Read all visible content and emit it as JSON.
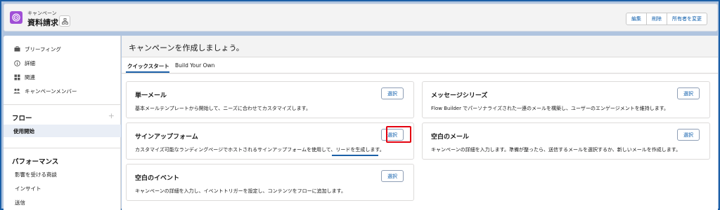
{
  "header": {
    "object_type": "キャンペーン",
    "title": "資料請求",
    "actions": [
      "編集",
      "削除",
      "所有者を変更"
    ],
    "icon": "campaign-target-icon"
  },
  "sidebar": {
    "top_items": [
      {
        "label": "ブリーフィング",
        "icon": "briefcase-icon"
      },
      {
        "label": "詳細",
        "icon": "info-icon"
      },
      {
        "label": "関連",
        "icon": "grid-icon"
      },
      {
        "label": "キャンペーンメンバー",
        "icon": "members-icon"
      }
    ],
    "flow_heading": "フロー",
    "flow_active": "使用開始",
    "performance_heading": "パフォーマンス",
    "performance_items": [
      "影響を受ける商談",
      "インサイト",
      "送信"
    ]
  },
  "main": {
    "title": "キャンペーンを作成しましょう。",
    "tabs": [
      "クイックスタート",
      "Build Your Own"
    ],
    "select_label": "選択",
    "cards": [
      {
        "title": "単一メール",
        "desc": "基本メールテンプレートから開始して、ニーズに合わせてカスタマイズします。"
      },
      {
        "title": "メッセージシリーズ",
        "desc": "Flow Builder でパーソナライズされた一連のメールを構築し、ユーザーのエンゲージメントを維持します。"
      },
      {
        "title": "サインアップフォーム",
        "desc": "カスタマイズ可能なランディングページでホストされるサインアップフォームを使用して、リードを生成します。"
      },
      {
        "title": "空白のメール",
        "desc": "キャンペーンの詳細を入力します。準備が整ったら、送信するメールを選択するか、新しいメールを作成します。"
      },
      {
        "title": "空白のイベント",
        "desc": "キャンペーンの詳細を入力し、イベントトリガーを設定し、コンテンツをフローに追加します。"
      }
    ]
  },
  "colors": {
    "brand_blue": "#1b5fa7",
    "campaign_icon": "#a04fd6",
    "highlight_red": "#e3010f"
  }
}
